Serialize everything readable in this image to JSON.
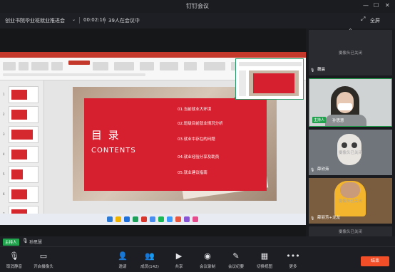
{
  "window": {
    "title": "钉钉会议"
  },
  "window_controls": {
    "minimize": "—",
    "maximize": "☐",
    "close": "✕"
  },
  "info_bar": {
    "meeting_name": "创业书院毕业班就业推进会",
    "duration": "00:02:16",
    "attendee_count": "39人在会议中",
    "fullscreen_label": "全屏"
  },
  "slide": {
    "title": "目 录",
    "subtitle": "CONTENTS",
    "toc": [
      "01.当前就业大环境",
      "02.班级目前就业情况分析",
      "03.就业中存在的问题",
      "04.就业经验分享及助员",
      "05.就业建议指南"
    ]
  },
  "slide_thumbs": [
    "1",
    "2",
    "3",
    "4",
    "5",
    "6",
    "7"
  ],
  "participants": [
    {
      "name": "魏晨",
      "camera_status": "摄像头已关闭"
    },
    {
      "name": "孙思慧",
      "role": "主持人"
    },
    {
      "name": "薛欣茹",
      "camera_status": "摄像头已关闭"
    },
    {
      "name": "薛丽芳+龙龙",
      "camera_status": "摄像头已关闭"
    },
    {
      "name": "",
      "camera_status": "摄像头已关闭"
    }
  ],
  "host_bar": {
    "badge": "主持人",
    "name": "孙思慧"
  },
  "toolbar": {
    "items": [
      {
        "label": "取消静音",
        "icon": "mic-off-icon"
      },
      {
        "label": "开启摄像头",
        "icon": "camera-off-icon"
      },
      {
        "label": "邀请",
        "icon": "invite-icon"
      },
      {
        "label": "成员(142)",
        "icon": "members-icon"
      },
      {
        "label": "共享",
        "icon": "share-icon"
      },
      {
        "label": "会议录制",
        "icon": "record-icon"
      },
      {
        "label": "会议纪要",
        "icon": "notes-icon"
      },
      {
        "label": "切换视图",
        "icon": "view-icon"
      },
      {
        "label": "更多",
        "icon": "more-icon"
      }
    ],
    "end_label": "结束"
  },
  "colors": {
    "accent_green": "#21a34e",
    "end_red": "#f24e28",
    "slide_red": "#d6202f"
  }
}
